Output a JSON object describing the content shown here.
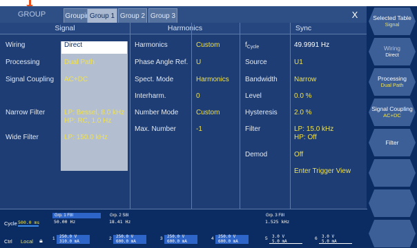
{
  "tabbar": {
    "group_label": "GROUP",
    "tabs": [
      "Grouping",
      "Group 1",
      "Group 2",
      "Group 3"
    ],
    "active_tab": "Group 1",
    "close_label": "X"
  },
  "columns": {
    "signal": "Signal",
    "harmonics": "Harmonics",
    "sync": "Sync"
  },
  "signal": {
    "wiring_label": "Wiring",
    "wiring_value": "Direct",
    "processing_label": "Processing",
    "processing_value": "Dual Path",
    "coupling_label": "Signal Coupling",
    "coupling_value": "AC+DC",
    "narrow_label": "Narrow Filter",
    "narrow_value_1": "LP: Bessel, 8.0 kHz",
    "narrow_value_2": "HP: RC, 1.0 Hz",
    "wide_label": "Wide Filter",
    "wide_value": "LP: 150.0 kHz"
  },
  "harmonics": {
    "harmonics_label": "Harmonics",
    "harmonics_value": "Custom",
    "phase_label": "Phase Angle Ref.",
    "phase_value": "U",
    "spect_label": "Spect. Mode",
    "spect_value": "Harmonics",
    "interharm_label": "Interharm.",
    "interharm_value": "0",
    "number_label": "Number Mode",
    "number_value": "Custom",
    "max_label": "Max. Number",
    "max_value": "-1"
  },
  "sync": {
    "f_label": "f",
    "f_sub": "Cycle",
    "f_value": "49.9991 Hz",
    "source_label": "Source",
    "source_value": "U1",
    "bandwidth_label": "Bandwidth",
    "bandwidth_value": "Narrow",
    "level_label": "Level",
    "level_value": "0.0 %",
    "hysteresis_label": "Hysteresis",
    "hysteresis_value": "2.0 %",
    "filter_label": "Filter",
    "filter_value_1": "LP: 15.0 kHz",
    "filter_value_2": "HP: Off",
    "demod_label": "Demod",
    "demod_value": "Off",
    "trigger_link": "Enter Trigger View"
  },
  "softkeys": [
    {
      "label": "Selected Table",
      "value": "Signal"
    },
    {
      "label": "Wiring",
      "value": "Direct"
    },
    {
      "label": "Processing",
      "value": "Dual Path"
    },
    {
      "label": "Signal Coupling",
      "value": "AC+DC"
    },
    {
      "label": "Filter",
      "value": ""
    },
    {
      "label": "",
      "value": ""
    },
    {
      "label": "",
      "value": ""
    },
    {
      "label": "",
      "value": ""
    }
  ],
  "status": {
    "cycle_label": "Cycle",
    "cycle_value": "500.0 ms",
    "ctrl_label": "Ctrl",
    "ctrl_value": "Local",
    "grp1": {
      "header": "Grp. 1 F8I",
      "freq": "50.00  Hz",
      "ch1_u": "250.0 V",
      "ch1_i": "310.0 mA"
    },
    "grp2": {
      "header": "Grp. 2 S8I",
      "freq": "18.41  Hz",
      "ch2_u": "250.0 V",
      "ch2_i": "600.0 mA",
      "ch3_u": "250.0 V",
      "ch3_i": "600.0 mA",
      "ch4_u": "250.0 V",
      "ch4_i": "600.0 mA"
    },
    "grp3": {
      "header": "Grp. 3 F8I",
      "freq": "1.525 kHz",
      "ch5_u": "3.0 V",
      "ch5_i": "5.0 mA",
      "ch6_u": "3.0 V",
      "ch6_i": "5.0 mA"
    }
  },
  "colors": {
    "background": "#0a2c63",
    "value": "#f2e24c",
    "selection": "#b3bfd1",
    "marker": "#e8501c"
  }
}
